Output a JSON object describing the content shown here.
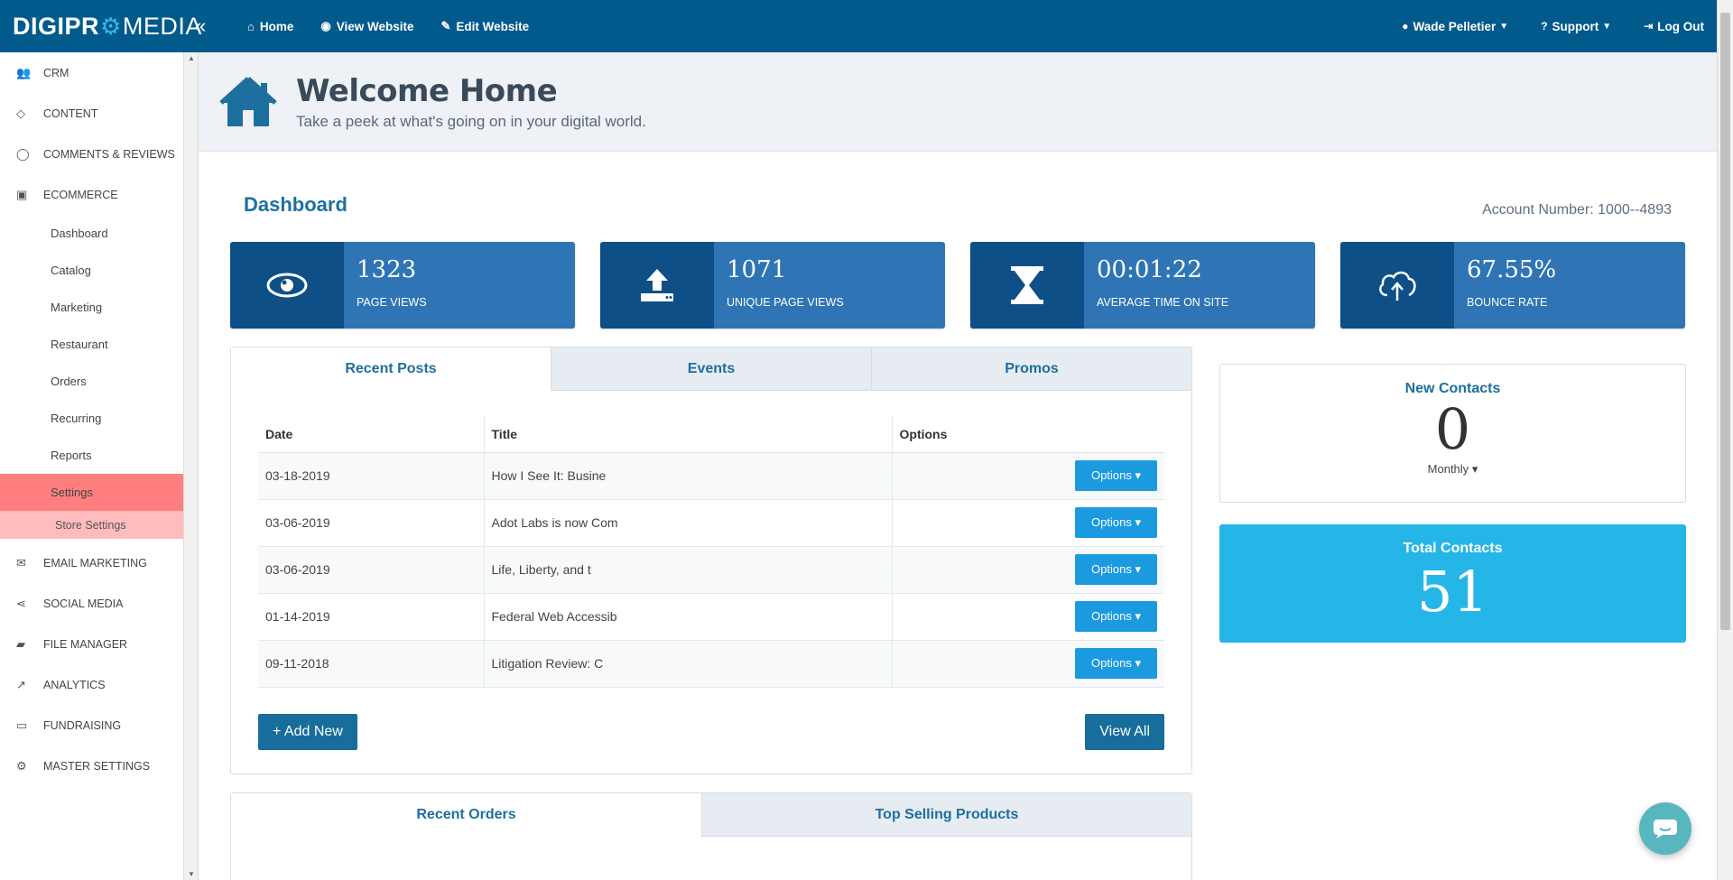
{
  "brand": {
    "logo_bold_1": "DIGIPR",
    "logo_bold_2": "O",
    "logo_rest": "MEDIA"
  },
  "topnav": {
    "collapse": "«",
    "items": [
      {
        "icon": "home-icon",
        "label": "Home"
      },
      {
        "icon": "eye-icon",
        "label": "View Website"
      },
      {
        "icon": "edit-icon",
        "label": "Edit Website"
      }
    ],
    "user": "Wade Pelletier",
    "support": "Support",
    "logout": "Log Out"
  },
  "sidebar": {
    "items": [
      {
        "icon": "users-icon",
        "label": "CRM"
      },
      {
        "icon": "diamond-icon",
        "label": "CONTENT"
      },
      {
        "icon": "comment-icon",
        "label": "COMMENTS & REVIEWS"
      },
      {
        "icon": "gift-icon",
        "label": "ECOMMERCE"
      }
    ],
    "ecommerce_sub": [
      "Dashboard",
      "Catalog",
      "Marketing",
      "Restaurant",
      "Orders",
      "Recurring",
      "Reports",
      "Settings"
    ],
    "settings_sub": "Store Settings",
    "items_after": [
      {
        "icon": "envelope-icon",
        "label": "EMAIL MARKETING"
      },
      {
        "icon": "share-icon",
        "label": "SOCIAL MEDIA"
      },
      {
        "icon": "folder-icon",
        "label": "FILE MANAGER"
      },
      {
        "icon": "line-chart-icon",
        "label": "ANALYTICS"
      },
      {
        "icon": "money-icon",
        "label": "FUNDRAISING"
      },
      {
        "icon": "gear-icon",
        "label": "MASTER SETTINGS"
      }
    ]
  },
  "header": {
    "title": "Welcome Home",
    "subtitle": "Take a peek at what's going on in your digital world."
  },
  "dashboard": {
    "title": "Dashboard",
    "account": "Account Number: 1000--4893",
    "stats": [
      {
        "icon": "eye-icon",
        "value": "1323",
        "label": "PAGE VIEWS"
      },
      {
        "icon": "upload-icon",
        "value": "1071",
        "label": "UNIQUE PAGE VIEWS"
      },
      {
        "icon": "hourglass-icon",
        "value": "00:01:22",
        "label": "AVERAGE TIME ON SITE"
      },
      {
        "icon": "cloud-upload-icon",
        "value": "67.55%",
        "label": "BOUNCE RATE"
      }
    ]
  },
  "posts": {
    "tabs": [
      "Recent Posts",
      "Events",
      "Promos"
    ],
    "columns": [
      "Date",
      "Title",
      "Options"
    ],
    "rows": [
      {
        "date": "03-18-2019",
        "title": "How I See It: Busine"
      },
      {
        "date": "03-06-2019",
        "title": "Adot Labs is now Com"
      },
      {
        "date": "03-06-2019",
        "title": "Life, Liberty, and t"
      },
      {
        "date": "01-14-2019",
        "title": "Federal Web Accessib"
      },
      {
        "date": "09-11-2018",
        "title": "Litigation Review: C"
      }
    ],
    "option_label": "Options",
    "add_new": "+ Add New",
    "view_all": "View All"
  },
  "contacts": {
    "new_title": "New Contacts",
    "new_value": "0",
    "period": "Monthly",
    "total_title": "Total Contacts",
    "total_value": "51"
  },
  "orders": {
    "tabs": [
      "Recent Orders",
      "Top Selling Products"
    ]
  },
  "colors": {
    "nav": "#005A8C",
    "stat": "#2f75b5",
    "stat_icon": "#0d4f86",
    "total": "#25b6e8",
    "settings_active": "#ff7f7f"
  }
}
